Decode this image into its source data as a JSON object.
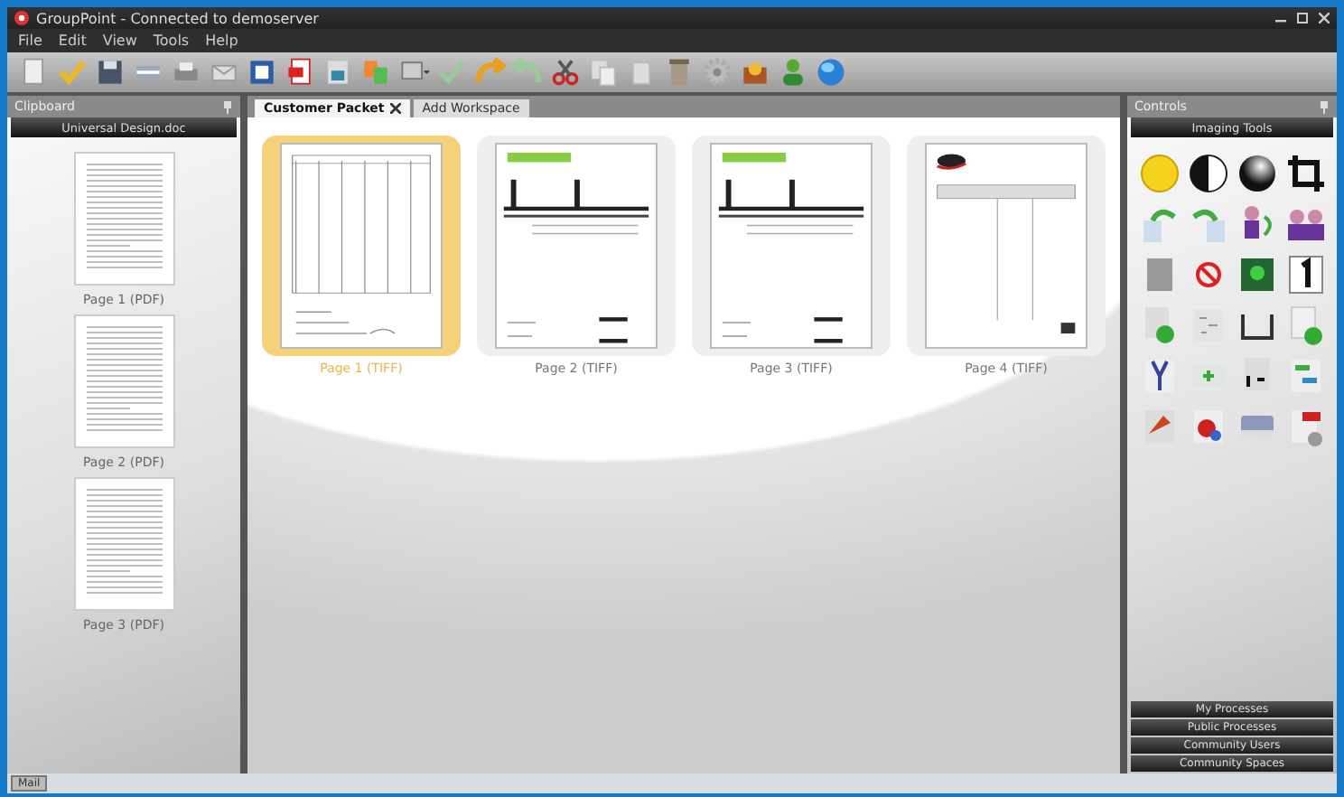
{
  "window": {
    "title": "GroupPoint - Connected to demoserver"
  },
  "menu": [
    {
      "label": "File"
    },
    {
      "label": "Edit"
    },
    {
      "label": "View"
    },
    {
      "label": "Tools"
    },
    {
      "label": "Help"
    }
  ],
  "clipboard": {
    "title": "Clipboard",
    "document": "Universal Design.doc",
    "pages": [
      {
        "label": "Page 1 (PDF)"
      },
      {
        "label": "Page 2 (PDF)"
      },
      {
        "label": "Page 3 (PDF)"
      }
    ]
  },
  "tabs": [
    {
      "label": "Customer Packet",
      "selected": true,
      "closable": true
    },
    {
      "label": "Add Workspace",
      "selected": false,
      "closable": false
    }
  ],
  "workspace": {
    "pages": [
      {
        "label": "Page 1 (TIFF)",
        "selected": true
      },
      {
        "label": "Page 2 (TIFF)",
        "selected": false
      },
      {
        "label": "Page 3 (TIFF)",
        "selected": false
      },
      {
        "label": "Page 4 (TIFF)",
        "selected": false
      }
    ]
  },
  "controls": {
    "title": "Controls",
    "section": "Imaging Tools",
    "sections": [
      {
        "label": "My Processes"
      },
      {
        "label": "Public Processes"
      },
      {
        "label": "Community Users"
      },
      {
        "label": "Community Spaces"
      }
    ]
  },
  "status_bar": {
    "button": "Mail"
  }
}
